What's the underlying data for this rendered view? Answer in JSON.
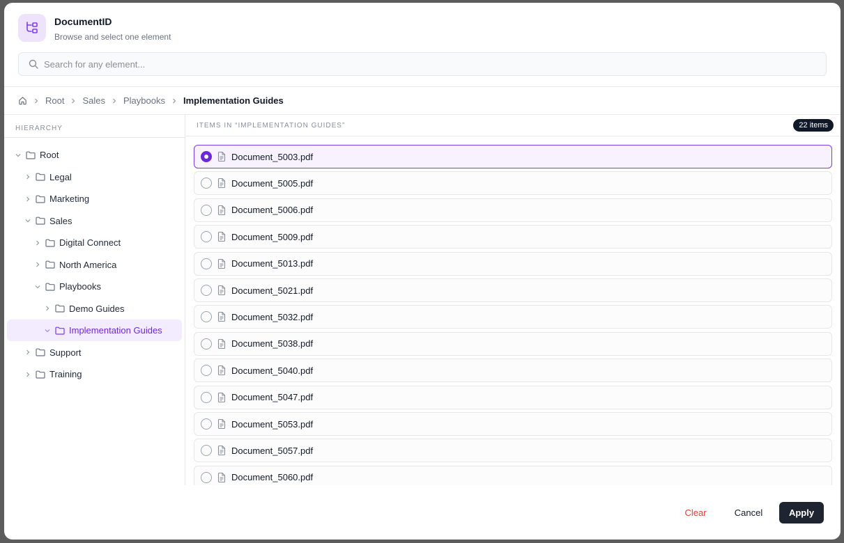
{
  "dialog": {
    "title": "DocumentID",
    "subtitle": "Browse and select one element"
  },
  "search": {
    "placeholder": "Search for any element..."
  },
  "breadcrumb": {
    "items": [
      "Root",
      "Sales",
      "Playbooks"
    ],
    "current": "Implementation Guides"
  },
  "sidebar": {
    "title": "HIERARCHY",
    "tree": [
      {
        "label": "Root",
        "level": 0,
        "expanded": true
      },
      {
        "label": "Legal",
        "level": 1,
        "expanded": false
      },
      {
        "label": "Marketing",
        "level": 1,
        "expanded": false
      },
      {
        "label": "Sales",
        "level": 1,
        "expanded": true
      },
      {
        "label": "Digital Connect",
        "level": 2,
        "expanded": false
      },
      {
        "label": "North America",
        "level": 2,
        "expanded": false
      },
      {
        "label": "Playbooks",
        "level": 2,
        "expanded": true
      },
      {
        "label": "Demo Guides",
        "level": 3,
        "expanded": false
      },
      {
        "label": "Implementation Guides",
        "level": 3,
        "expanded": true,
        "selected": true
      },
      {
        "label": "Support",
        "level": 1,
        "expanded": false
      },
      {
        "label": "Training",
        "level": 1,
        "expanded": false
      }
    ]
  },
  "main": {
    "title": "ITEMS IN “IMPLEMENTATION GUIDES”",
    "count_badge": "22 items",
    "items": [
      {
        "label": "Document_5003.pdf",
        "selected": true
      },
      {
        "label": "Document_5005.pdf"
      },
      {
        "label": "Document_5006.pdf"
      },
      {
        "label": "Document_5009.pdf"
      },
      {
        "label": "Document_5013.pdf"
      },
      {
        "label": "Document_5021.pdf"
      },
      {
        "label": "Document_5032.pdf"
      },
      {
        "label": "Document_5038.pdf"
      },
      {
        "label": "Document_5040.pdf"
      },
      {
        "label": "Document_5047.pdf"
      },
      {
        "label": "Document_5053.pdf"
      },
      {
        "label": "Document_5057.pdf"
      },
      {
        "label": "Document_5060.pdf"
      }
    ]
  },
  "footer": {
    "clear_label": "Clear",
    "cancel_label": "Cancel",
    "apply_label": "Apply"
  },
  "colors": {
    "accent": "#6d28d9",
    "danger": "#e0402f",
    "primary_button": "#1f2530"
  },
  "icons": {
    "app": "hierarchy-icon",
    "search": "search-icon",
    "home": "home-icon",
    "folder": "folder-icon",
    "document": "document-icon"
  }
}
